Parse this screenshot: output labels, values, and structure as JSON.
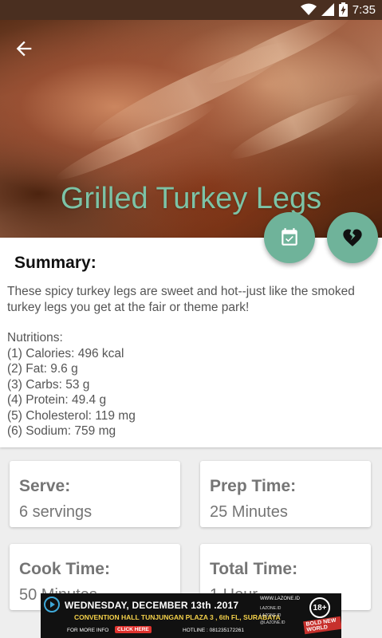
{
  "status_bar": {
    "time": "7:35"
  },
  "recipe": {
    "title": "Grilled Turkey Legs"
  },
  "summary": {
    "heading": "Summary:",
    "description": "These spicy turkey legs are sweet and hot--just like the smoked turkey legs you get at the fair or theme park!",
    "nutrition_title": "Nutritions:",
    "nutrition_items": [
      "(1) Calories: 496 kcal",
      "(2) Fat: 9.6 g",
      "(3) Carbs: 53 g",
      "(4) Protein: 49.4 g",
      "(5) Cholesterol: 119 mg",
      "(6) Sodium: 759 mg"
    ]
  },
  "info_cards": {
    "serve": {
      "label": "Serve:",
      "value": "6 servings"
    },
    "prep": {
      "label": "Prep Time:",
      "value": "25 Minutes"
    },
    "cook": {
      "label": "Cook Time:",
      "value": "50 Minutes"
    },
    "total": {
      "label": "Total Time:",
      "value": "1 Hour"
    }
  },
  "ad": {
    "line1": "WEDNESDAY, DECEMBER 13th .2017",
    "line2": "CONVENTION HALL TUNJUNGAN PLAZA 3 , 6th FL, SURABAYA",
    "more_info": "FOR MORE INFO",
    "click_here": "CLICK HERE",
    "hotline": "HOTLINE : 081235172261",
    "site": "WWW.LAZONE.ID",
    "social1": "LAZONE.ID",
    "social2": "LAZONE.ID",
    "social3": "@LAZONE.ID",
    "age": "18+",
    "badge": "BOLD NEW WORLD"
  },
  "colors": {
    "accent": "#6fb39a",
    "title": "#7cc3a6",
    "status_bar": "#4a2f20"
  },
  "icons": {
    "back": "arrow-left-icon",
    "calendar": "calendar-check-icon",
    "favorite": "broken-heart-icon",
    "wifi": "wifi-icon",
    "signal": "signal-icon",
    "battery": "battery-charging-icon"
  }
}
